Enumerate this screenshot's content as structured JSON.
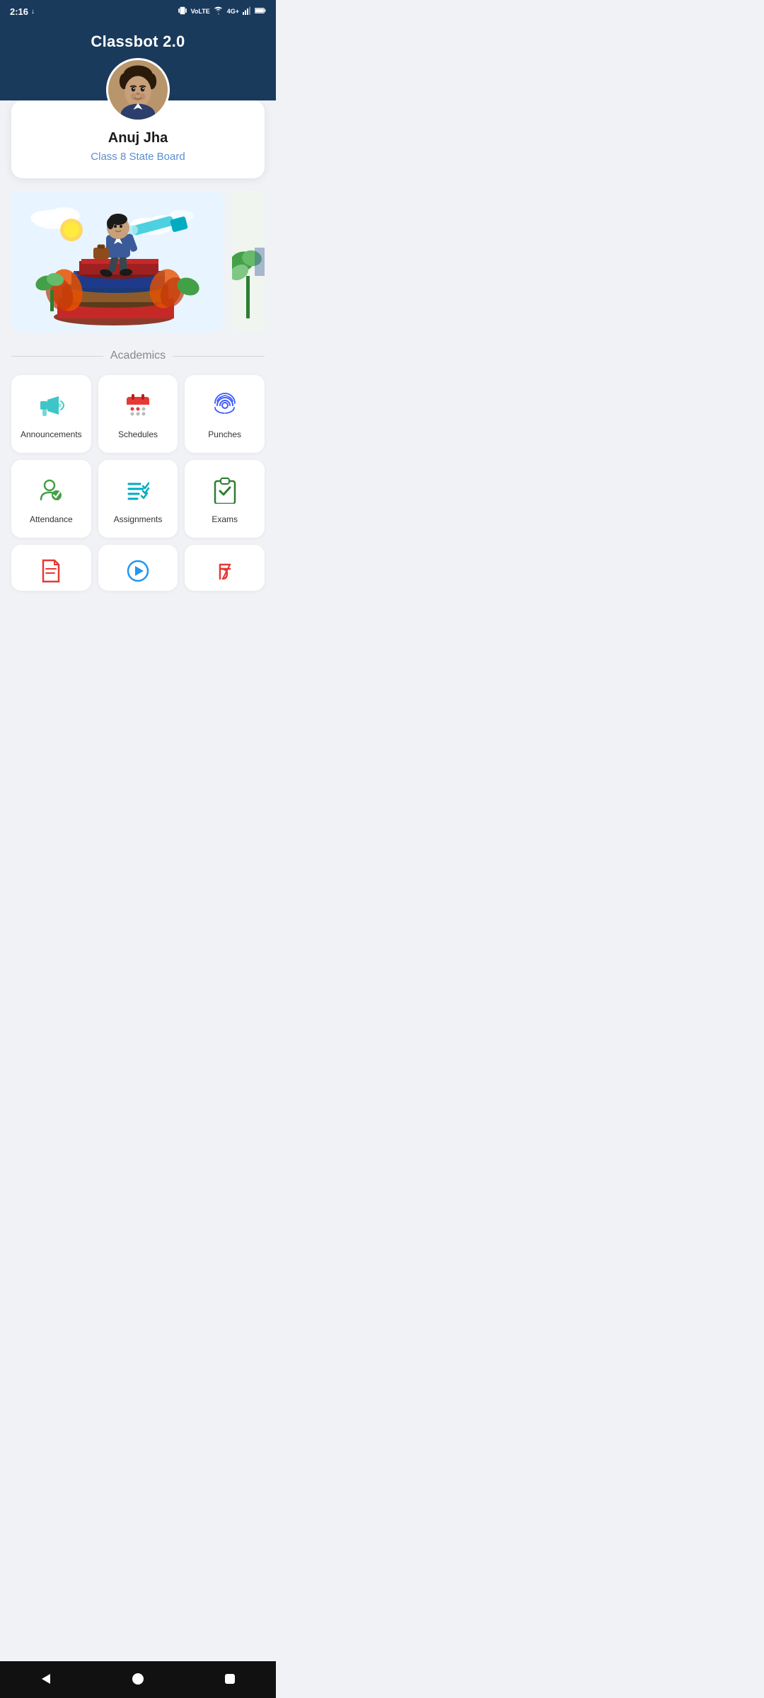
{
  "statusBar": {
    "time": "2:16",
    "downloadIcon": "↓"
  },
  "header": {
    "title": "Classbot 2.0"
  },
  "profile": {
    "name": "Anuj Jha",
    "class": "Class 8 State Board"
  },
  "academics": {
    "sectionTitle": "Academics",
    "gridItems": [
      {
        "id": "announcements",
        "label": "Announcements",
        "iconColor": "#3ec6c6"
      },
      {
        "id": "schedules",
        "label": "Schedules",
        "iconColor": "#e53935"
      },
      {
        "id": "punches",
        "label": "Punches",
        "iconColor": "#3d5afe"
      },
      {
        "id": "attendance",
        "label": "Attendance",
        "iconColor": "#43a047"
      },
      {
        "id": "assignments",
        "label": "Assignments",
        "iconColor": "#00acc1"
      },
      {
        "id": "exams",
        "label": "Exams",
        "iconColor": "#2e7d32"
      }
    ],
    "partialItems": [
      {
        "id": "doc",
        "iconColor": "#e53935"
      },
      {
        "id": "play",
        "iconColor": "#2196f3"
      },
      {
        "id": "rupee",
        "iconColor": "#e53935"
      }
    ]
  },
  "navBar": {
    "back": "◀",
    "home": "●",
    "square": "■"
  }
}
